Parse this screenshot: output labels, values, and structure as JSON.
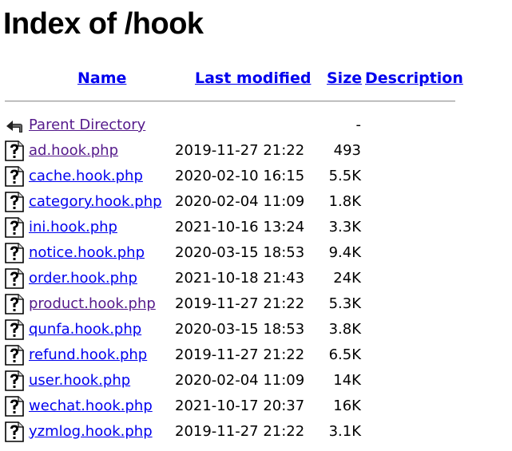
{
  "page": {
    "title": "Index of /hook"
  },
  "headers": {
    "name": "Name",
    "last_modified": "Last modified",
    "size": "Size",
    "description": "Description"
  },
  "parent": {
    "label": "Parent Directory",
    "size": "-",
    "icon": "back-arrow-icon"
  },
  "files": [
    {
      "name": "ad.hook.php",
      "modified": "2019-11-27 21:22",
      "size": "493",
      "visited": true
    },
    {
      "name": "cache.hook.php",
      "modified": "2020-02-10 16:15",
      "size": "5.5K",
      "visited": false
    },
    {
      "name": "category.hook.php",
      "modified": "2020-02-04 11:09",
      "size": "1.8K",
      "visited": false
    },
    {
      "name": "ini.hook.php",
      "modified": "2021-10-16 13:24",
      "size": "3.3K",
      "visited": false
    },
    {
      "name": "notice.hook.php",
      "modified": "2020-03-15 18:53",
      "size": "9.4K",
      "visited": false
    },
    {
      "name": "order.hook.php",
      "modified": "2021-10-18 21:43",
      "size": "24K",
      "visited": false
    },
    {
      "name": "product.hook.php",
      "modified": "2019-11-27 21:22",
      "size": "5.3K",
      "visited": true
    },
    {
      "name": "qunfa.hook.php",
      "modified": "2020-03-15 18:53",
      "size": "3.8K",
      "visited": false
    },
    {
      "name": "refund.hook.php",
      "modified": "2019-11-27 21:22",
      "size": "6.5K",
      "visited": false
    },
    {
      "name": "user.hook.php",
      "modified": "2020-02-04 11:09",
      "size": "14K",
      "visited": false
    },
    {
      "name": "wechat.hook.php",
      "modified": "2021-10-17 20:37",
      "size": "16K",
      "visited": false
    },
    {
      "name": "yzmlog.hook.php",
      "modified": "2019-11-27 21:22",
      "size": "3.1K",
      "visited": false
    }
  ],
  "colors": {
    "link": "#0000ee",
    "visited": "#551a8b"
  }
}
